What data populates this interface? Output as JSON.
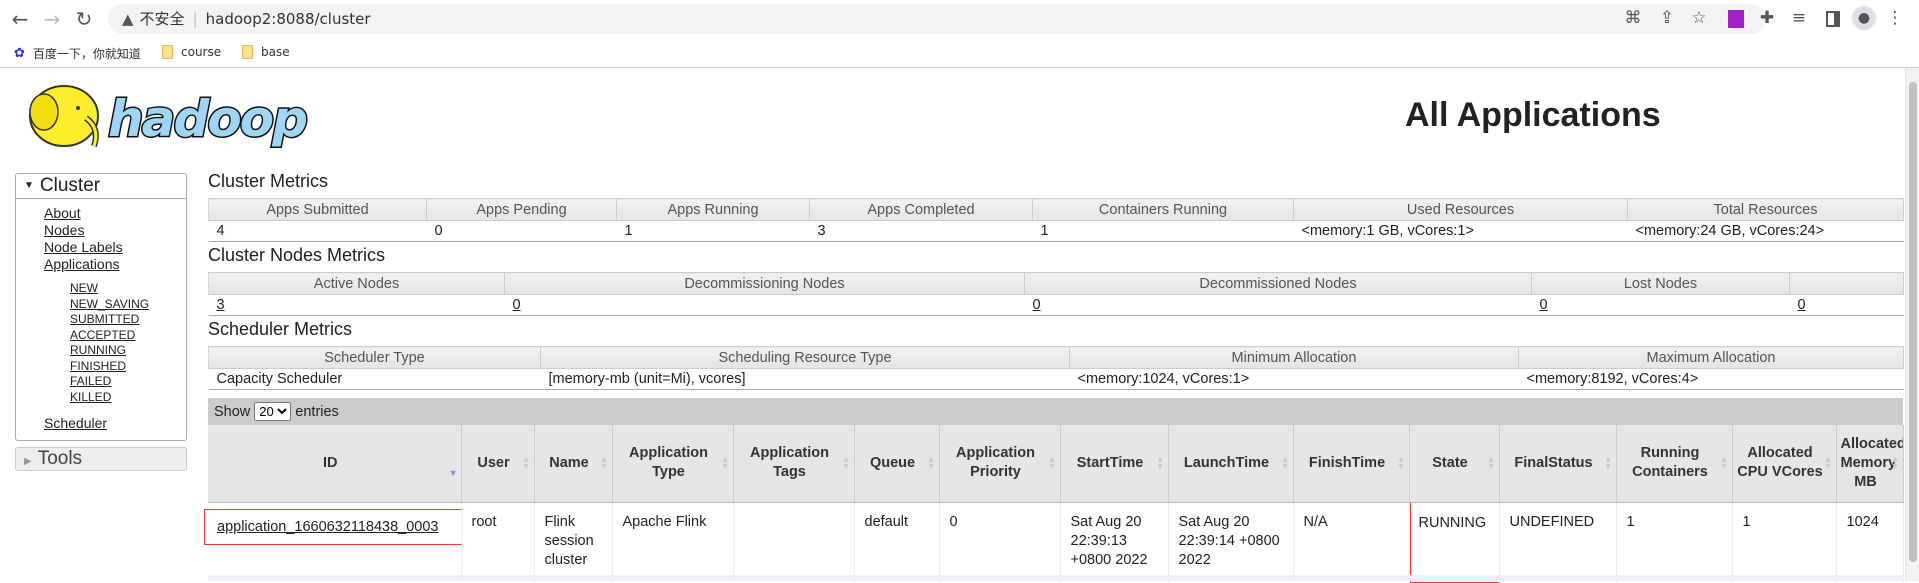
{
  "browser": {
    "security_label": "不安全",
    "url": "hadoop2:8088/cluster",
    "bookmarks": [
      {
        "label": "百度一下，你就知道",
        "icon": "baidu-paw-icon"
      },
      {
        "label": "course",
        "icon": "folder-icon"
      },
      {
        "label": "base",
        "icon": "folder-icon"
      }
    ]
  },
  "logo_text": "hadoop",
  "page_title": "All Applications",
  "sidebar": {
    "cluster_label": "Cluster",
    "links": [
      "About",
      "Nodes",
      "Node Labels",
      "Applications"
    ],
    "app_states": [
      "NEW",
      "NEW_SAVING",
      "SUBMITTED",
      "ACCEPTED",
      "RUNNING",
      "FINISHED",
      "FAILED",
      "KILLED"
    ],
    "scheduler": "Scheduler",
    "tools_label": "Tools"
  },
  "cluster_metrics": {
    "title": "Cluster Metrics",
    "headers": [
      "Apps Submitted",
      "Apps Pending",
      "Apps Running",
      "Apps Completed",
      "Containers Running",
      "Used Resources",
      "Total Resources"
    ],
    "values": [
      "4",
      "0",
      "1",
      "3",
      "1",
      "<memory:1 GB, vCores:1>",
      "<memory:24 GB, vCores:24>"
    ]
  },
  "nodes_metrics": {
    "title": "Cluster Nodes Metrics",
    "headers": [
      "Active Nodes",
      "Decommissioning Nodes",
      "Decommissioned Nodes",
      "Lost Nodes",
      ""
    ],
    "values": [
      "3",
      "0",
      "0",
      "0",
      "0"
    ]
  },
  "scheduler_metrics": {
    "title": "Scheduler Metrics",
    "headers": [
      "Scheduler Type",
      "Scheduling Resource Type",
      "Minimum Allocation",
      "Maximum Allocation"
    ],
    "values": [
      "Capacity Scheduler",
      "[memory-mb (unit=Mi), vcores]",
      "<memory:1024, vCores:1>",
      "<memory:8192, vCores:4>"
    ]
  },
  "apps_table": {
    "show_label": "Show",
    "entries_label": "entries",
    "page_size": "20",
    "headers": [
      "ID",
      "User",
      "Name",
      "Application Type",
      "Application Tags",
      "Queue",
      "Application Priority",
      "StartTime",
      "LaunchTime",
      "FinishTime",
      "State",
      "FinalStatus",
      "Running Containers",
      "Allocated CPU VCores",
      "Allocated Memory MB"
    ],
    "rows": [
      [
        "application_1660632118438_0003",
        "root",
        "Flink session cluster",
        "Apache Flink",
        "",
        "default",
        "0",
        "Sat Aug 20 22:39:13 +0800 2022",
        "Sat Aug 20 22:39:14 +0800 2022",
        "N/A",
        "RUNNING",
        "UNDEFINED",
        "1",
        "1",
        "1024"
      ]
    ]
  },
  "colors": {
    "highlight_box": "#e33333",
    "logo_blue": "#9dd7f5",
    "elephant_yellow": "#ffee2a"
  }
}
